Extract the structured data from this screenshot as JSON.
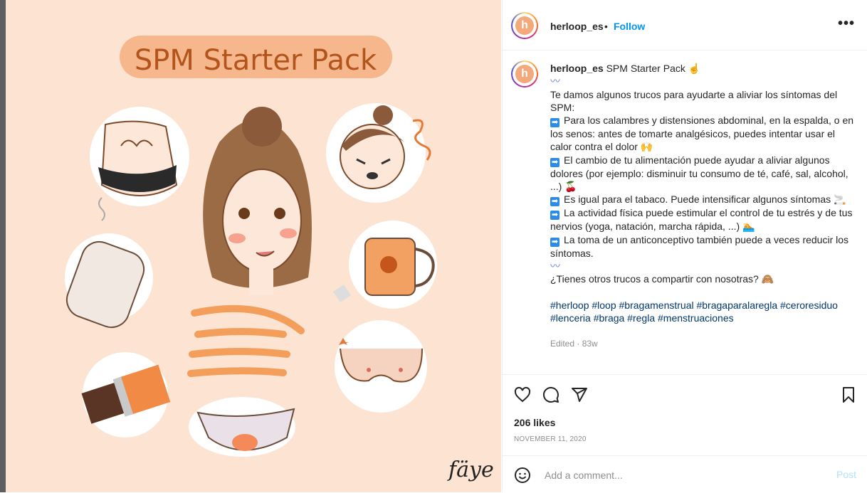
{
  "post": {
    "image_title": "SPM Starter Pack",
    "signature": "fäye",
    "colors": {
      "background": "#fde4d2",
      "title_pill": "#f7b78c",
      "accent": "#f49e5c"
    }
  },
  "header": {
    "username": "herloop_es",
    "separator": "•",
    "follow_label": "Follow",
    "more_label": "•••"
  },
  "caption": {
    "username": "herloop_es",
    "title": "SPM Starter Pack",
    "title_emoji": "☝",
    "squiggle": "〰",
    "intro": "Te damos algunos trucos para ayudarte a aliviar los síntomas del SPM:",
    "tips": [
      {
        "text": "Para los calambres y distensiones abdominal, en la espalda, o en los senos: antes de tomarte analgésicos, puedes intentar usar el calor contra el dolor",
        "emoji": "🙌"
      },
      {
        "text": "El cambio de tu alimentación puede ayudar a aliviar algunos dolores (por ejemplo: disminuir tu consumo de té, café, sal, alcohol, ...)",
        "emoji": "🍒"
      },
      {
        "text": "Es igual para el tabaco. Puede intensificar algunos síntomas",
        "emoji": "🚬"
      },
      {
        "text": "La actividad física puede estimular el control de tu estrés y de tus nervios (yoga, natación, marcha rápida, ...)",
        "emoji": "🏊"
      },
      {
        "text": "La toma de un anticonceptivo también puede a veces reducir los síntomas.",
        "emoji": ""
      }
    ],
    "arrow_glyph": "➡",
    "question": "¿Tienes otros trucos a compartir con nosotras?",
    "question_emoji": "🙈",
    "hashtags": "#herloop #loop #bragamenstrual #bragaparalaregla #ceroresiduo #lenceria #braga #regla #menstruaciones",
    "edited": "Edited · 83w"
  },
  "actions": {
    "icons": [
      "heart-icon",
      "comment-icon",
      "share-icon",
      "bookmark-icon"
    ]
  },
  "likes": "206 likes",
  "date": "NOVEMBER 11, 2020",
  "comment": {
    "placeholder": "Add a comment...",
    "post_label": "Post"
  }
}
